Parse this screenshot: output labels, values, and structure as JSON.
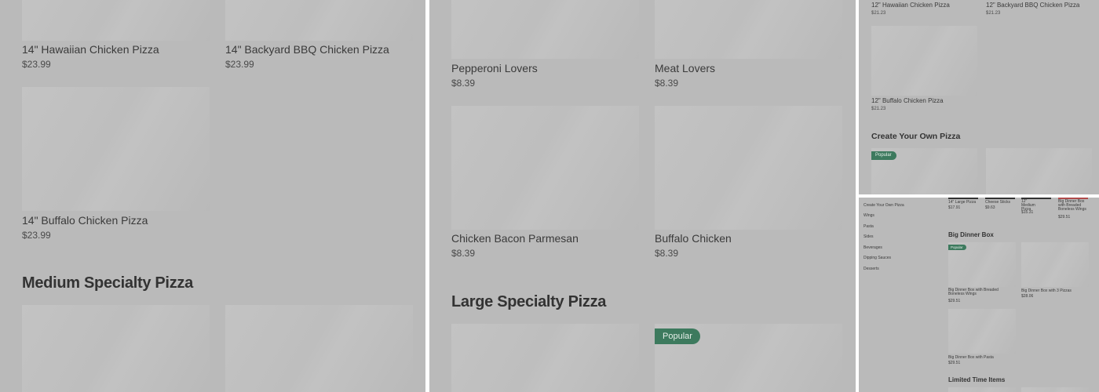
{
  "panel1": {
    "row1": [
      {
        "name": "14\" Hawaiian Chicken Pizza",
        "price": "$23.99"
      },
      {
        "name": "14\" Backyard BBQ Chicken Pizza",
        "price": "$23.99"
      }
    ],
    "row2": [
      {
        "name": "14\" Buffalo Chicken Pizza",
        "price": "$23.99"
      }
    ],
    "section_heading": "Medium Specialty Pizza"
  },
  "panel2": {
    "row1": [
      {
        "name": "Pepperoni Lovers",
        "price": "$8.39"
      },
      {
        "name": "Meat Lovers",
        "price": "$8.39"
      }
    ],
    "row2": [
      {
        "name": "Chicken Bacon Parmesan",
        "price": "$8.39"
      },
      {
        "name": "Buffalo Chicken",
        "price": "$8.39"
      }
    ],
    "section_heading": "Large Specialty Pizza",
    "badge": "Popular"
  },
  "panel3": {
    "row1": [
      {
        "name": "12\" Hawaiian Chicken Pizza",
        "price": "$21.23"
      },
      {
        "name": "12\" Backyard BBQ Chicken Pizza",
        "price": "$21.23"
      }
    ],
    "row2": [
      {
        "name": "12\" Buffalo Chicken Pizza",
        "price": "$21.23"
      }
    ],
    "section_heading": "Create Your Own Pizza",
    "badge": "Popular"
  },
  "panel4": {
    "sidebar": [
      "Create Your Own Pizza",
      "Wings",
      "Pasta",
      "Sides",
      "Beverages",
      "Dipping Sauces",
      "Desserts"
    ],
    "top_items": [
      {
        "name": "14\" Large Pizza",
        "price": "$17.91",
        "bar_color": "#333333"
      },
      {
        "name": "Cheese Sticks",
        "price": "$9.63",
        "bar_color": "#333333"
      },
      {
        "name": "12\" Medium Pizza",
        "price": "$15.31",
        "bar_color": "#333333"
      },
      {
        "name": "Big Dinner Box with Breaded Boneless Wings",
        "price": "$29.51",
        "bar_color": "#b04a4a"
      }
    ],
    "section_heading": "Big Dinner Box",
    "badge": "Popular",
    "dinner_items": [
      {
        "name": "Big Dinner Box with Breaded Boneless Wings",
        "price": "$29.51"
      },
      {
        "name": "Big Dinner Box with 3 Pizzas",
        "price": "$28.06"
      },
      {
        "name": "Big Dinner Box with Pasta",
        "price": "$29.51"
      }
    ],
    "limited_heading": "Limited Time Items"
  }
}
